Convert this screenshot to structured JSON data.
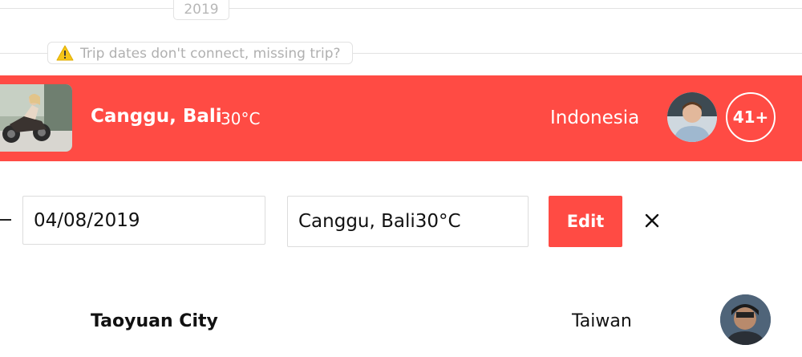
{
  "timeline": {
    "year": "2019",
    "warning_icon": "warning-icon",
    "warning_text": "Trip dates don't connect, missing trip?"
  },
  "trip": {
    "city": "Canggu, Bali",
    "temperature": "30°C",
    "country": "Indonesia",
    "traveler_count": "41+",
    "accent_color": "#ff4b44"
  },
  "edit_form": {
    "date_value": "04/08/2019",
    "location_value": "Canggu, Bali30°C",
    "edit_label": "Edit",
    "close_icon": "close-icon"
  },
  "next_trip": {
    "city": "Taoyuan City",
    "country": "Taiwan"
  }
}
